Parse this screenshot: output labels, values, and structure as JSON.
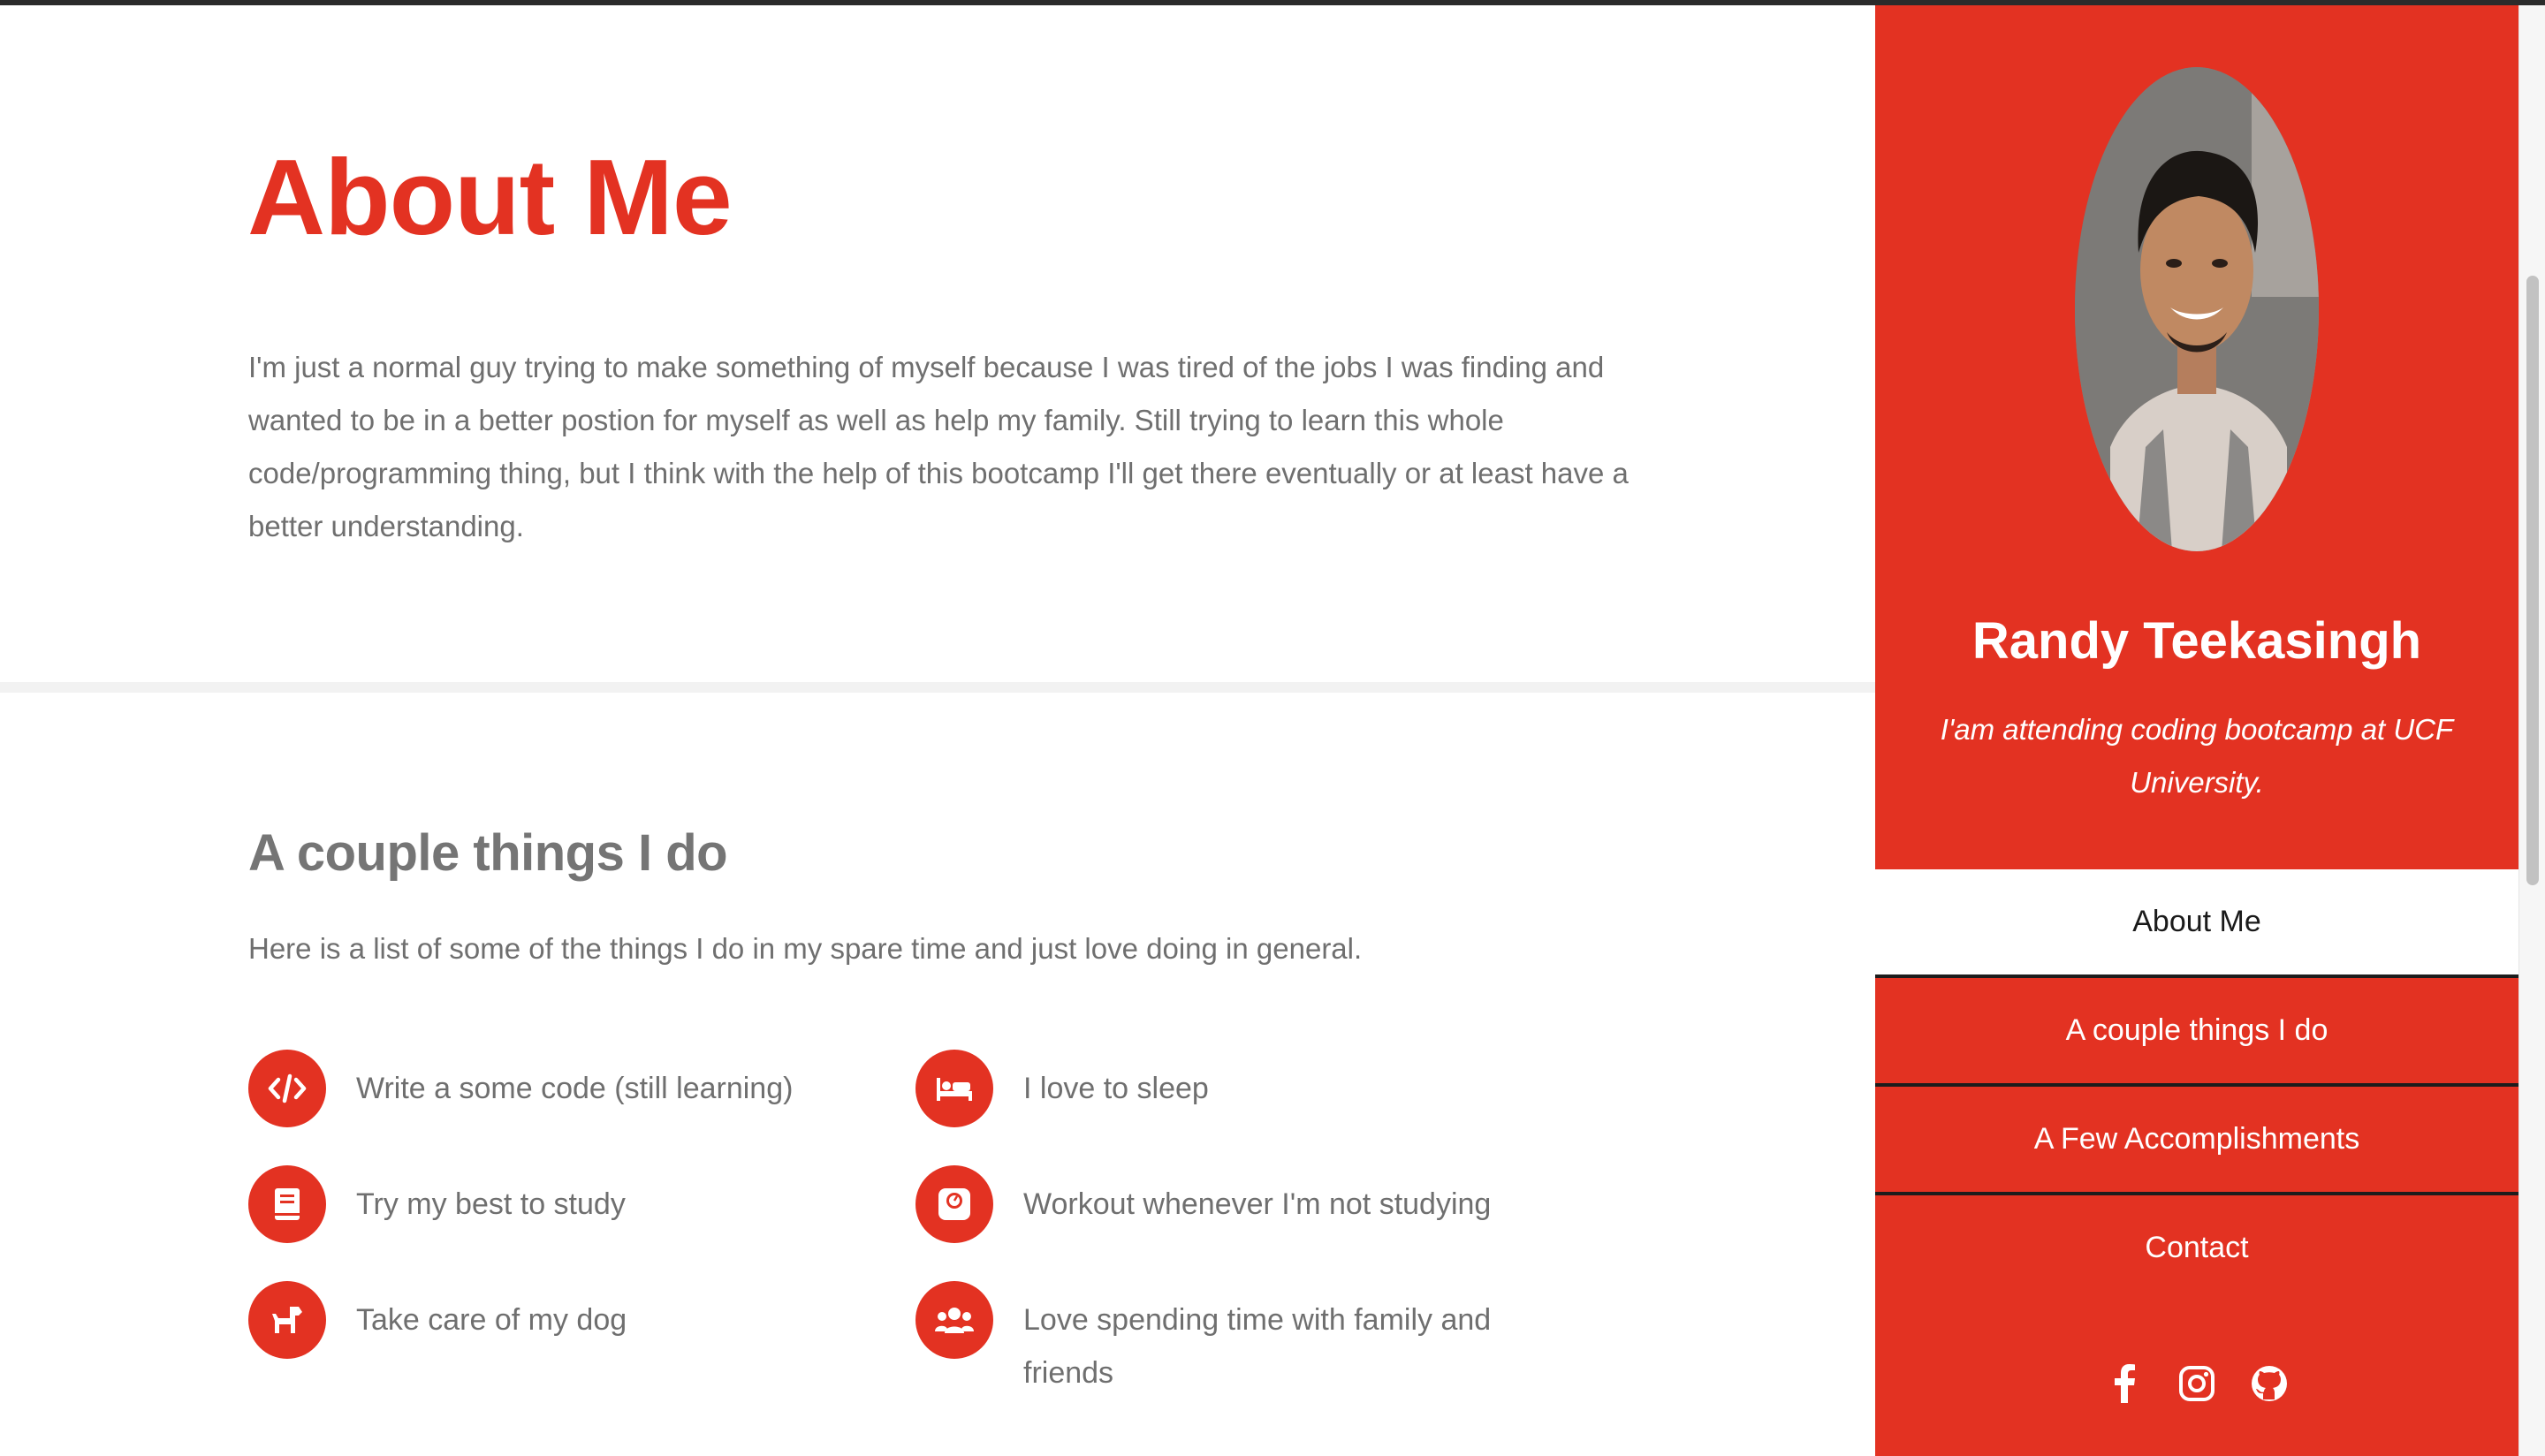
{
  "about": {
    "title": "About Me",
    "text": "I'm just a normal guy trying to make something of myself because I was tired of the jobs I was finding and wanted to be in a better postion for myself as well as help my family. Still trying to learn this whole code/programming thing, but I think with the help of this bootcamp I'll get there eventually or at least have a better understanding."
  },
  "things": {
    "title": "A couple things I do",
    "intro": "Here is a list of some of the things I do in my spare time and just love doing in general.",
    "items": [
      {
        "label": "Write a some code (still learning)",
        "icon": "code-icon"
      },
      {
        "label": "I love to sleep",
        "icon": "bed-icon"
      },
      {
        "label": "Try my best to study",
        "icon": "book-icon"
      },
      {
        "label": "Workout whenever I'm not studying",
        "icon": "weight-scale-icon"
      },
      {
        "label": "Take care of my dog",
        "icon": "dog-icon"
      },
      {
        "label": "Love spending time with family and friends",
        "icon": "users-icon"
      }
    ]
  },
  "sidebar": {
    "name": "Randy Teekasingh",
    "tagline": "I'am attending coding bootcamp at UCF University.",
    "nav": [
      {
        "label": "About Me",
        "active": true
      },
      {
        "label": "A couple things I do",
        "active": false
      },
      {
        "label": "A Few Accomplishments",
        "active": false
      },
      {
        "label": "Contact",
        "active": false
      }
    ],
    "social": [
      "facebook-icon",
      "instagram-icon",
      "github-icon"
    ]
  },
  "colors": {
    "accent": "#e33222",
    "text": "#6f6f6f",
    "heading": "#757575"
  }
}
